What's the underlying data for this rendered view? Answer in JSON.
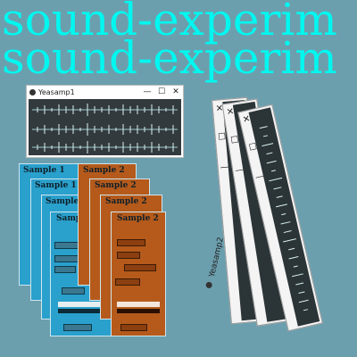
{
  "title": "sound-experim",
  "title_color": "#00f7f0",
  "background_color": "#6c9fae",
  "small_window": {
    "title": "Yeasamp1",
    "controls": [
      "—",
      "☐",
      "✕"
    ]
  },
  "left_stack": {
    "cards": [
      {
        "label": "Sample 1"
      },
      {
        "label": "Sample 1"
      },
      {
        "label": "Sample 1"
      },
      {
        "label": "Sample 1"
      }
    ]
  },
  "right_stack": {
    "cards": [
      {
        "label": "Sample 2"
      },
      {
        "label": "Sample 2"
      },
      {
        "label": "Sample 2"
      },
      {
        "label": "Sample 2"
      }
    ]
  },
  "rotated_windows": {
    "title": "Yeasamp2",
    "controls": [
      "✕",
      "☐",
      "—"
    ]
  }
}
